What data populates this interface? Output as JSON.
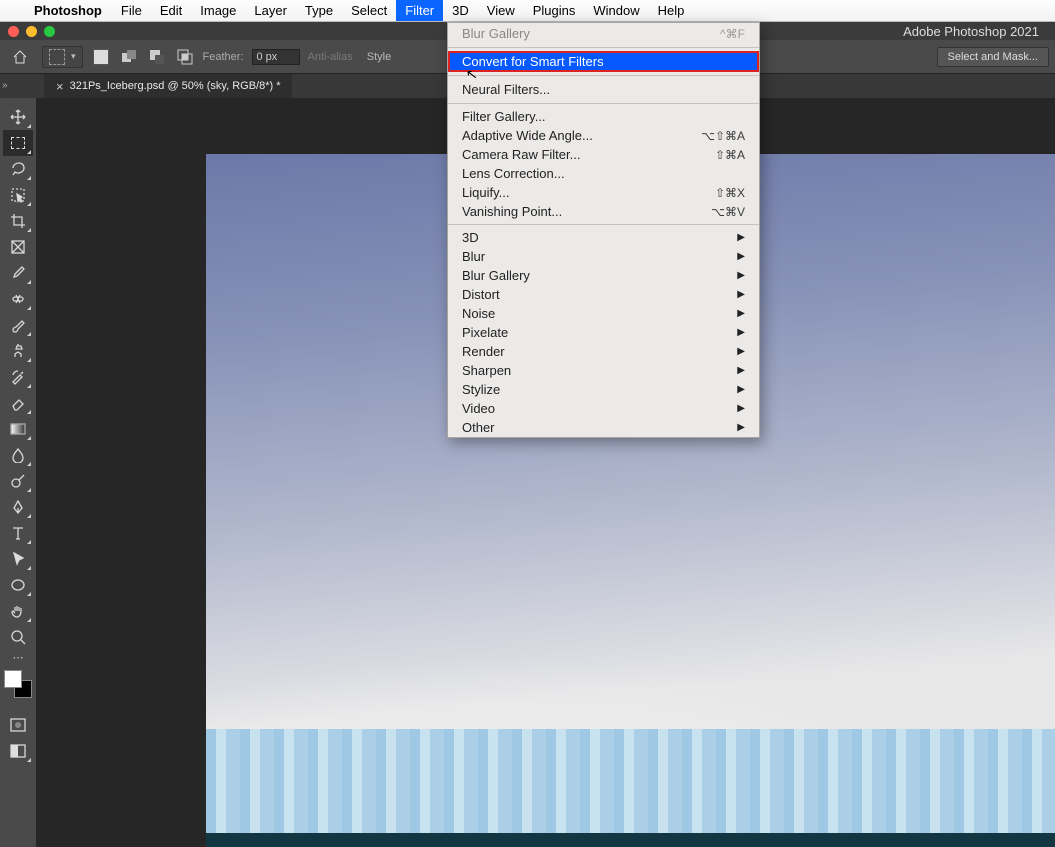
{
  "menubar": {
    "app": "Photoshop",
    "items": [
      "File",
      "Edit",
      "Image",
      "Layer",
      "Type",
      "Select",
      "Filter",
      "3D",
      "View",
      "Plugins",
      "Window",
      "Help"
    ],
    "active": "Filter"
  },
  "window_title": "Adobe Photoshop 2021",
  "options": {
    "feather_label": "Feather:",
    "feather_value": "0 px",
    "antialias_label": "Anti-alias",
    "style_label": "Style",
    "select_mask_btn": "Select and Mask..."
  },
  "tab": {
    "title": "321Ps_Iceberg.psd @ 50% (sky, RGB/8*) *"
  },
  "filter_menu": {
    "last": {
      "label": "Blur Gallery",
      "shortcut": "^⌘F"
    },
    "convert": "Convert for Smart Filters",
    "neural": "Neural Filters...",
    "items2": [
      {
        "label": "Filter Gallery...",
        "shortcut": ""
      },
      {
        "label": "Adaptive Wide Angle...",
        "shortcut": "⌥⇧⌘A"
      },
      {
        "label": "Camera Raw Filter...",
        "shortcut": "⇧⌘A"
      },
      {
        "label": "Lens Correction...",
        "shortcut": ""
      },
      {
        "label": "Liquify...",
        "shortcut": "⇧⌘X"
      },
      {
        "label": "Vanishing Point...",
        "shortcut": "⌥⌘V"
      }
    ],
    "subs": [
      "3D",
      "Blur",
      "Blur Gallery",
      "Distort",
      "Noise",
      "Pixelate",
      "Render",
      "Sharpen",
      "Stylize",
      "Video",
      "Other"
    ]
  },
  "tools": [
    "move",
    "marquee",
    "lasso",
    "object-select",
    "crop",
    "frame",
    "eyedropper",
    "healing",
    "brush",
    "clone",
    "history-brush",
    "eraser",
    "gradient",
    "blur",
    "dodge",
    "pen",
    "type",
    "path-select",
    "ellipse",
    "hand",
    "zoom"
  ],
  "extras": [
    "quickmask",
    "screenmode"
  ]
}
